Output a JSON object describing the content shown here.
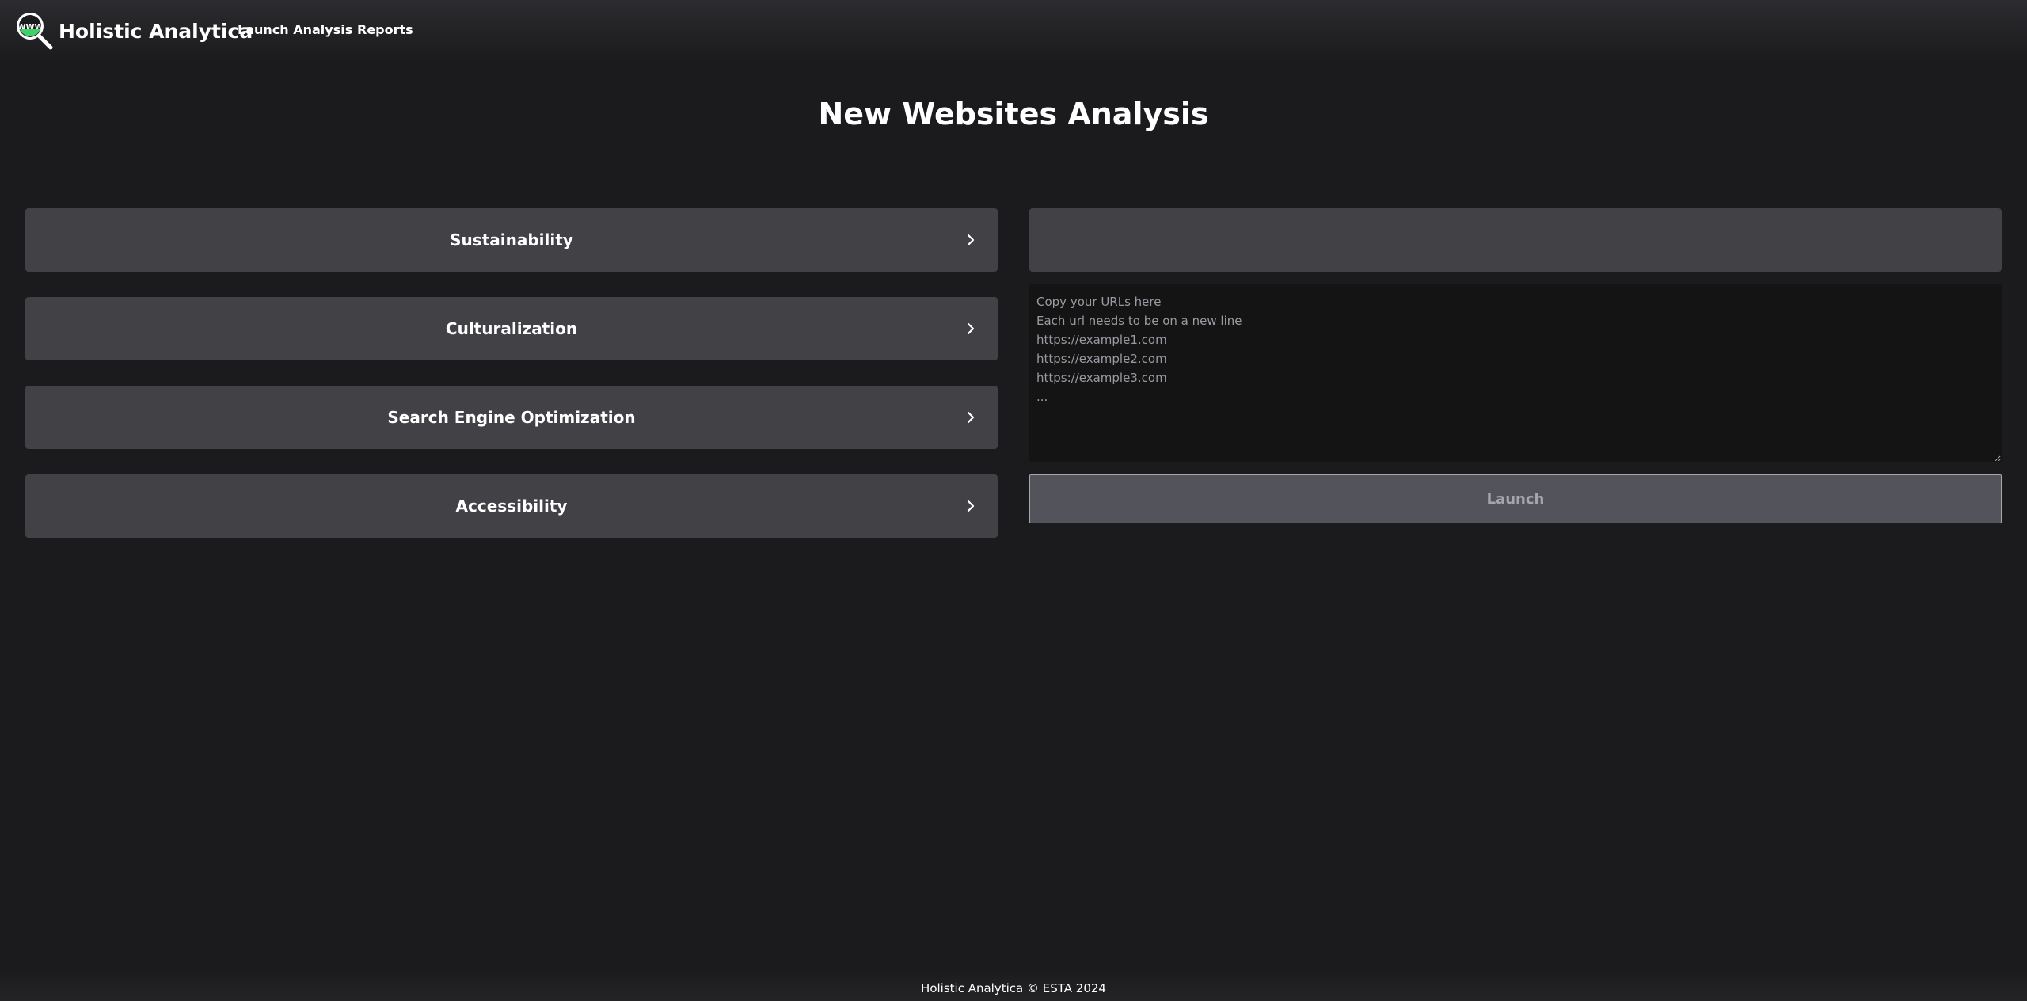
{
  "app": {
    "brand_name": "Holistic Analytica",
    "logo_icon": "magnifier-www-icon",
    "logo_text": "WWW"
  },
  "nav": {
    "launch_analysis": "Launch Analysis",
    "reports": "Reports"
  },
  "page": {
    "title": "New Websites Analysis"
  },
  "categories": [
    {
      "label": "Sustainability",
      "icon": "chevron-right-icon"
    },
    {
      "label": "Culturalization",
      "icon": "chevron-right-icon"
    },
    {
      "label": "Search Engine Optimization",
      "icon": "chevron-right-icon"
    },
    {
      "label": "Accessibility",
      "icon": "chevron-right-icon"
    }
  ],
  "form": {
    "name_value": "",
    "urls_placeholder": "Copy your URLs here\nEach url needs to be on a new line\nhttps://example1.com\nhttps://example2.com\nhttps://example3.com\n...",
    "launch_label": "Launch"
  },
  "footer": {
    "text": "Holistic Analytica © ESTA 2024"
  },
  "colors": {
    "background": "#1b1b1e",
    "panel": "#414146",
    "textarea_bg": "#141414",
    "button_bg": "#53535c",
    "logo_accent": "#3fd06a"
  }
}
